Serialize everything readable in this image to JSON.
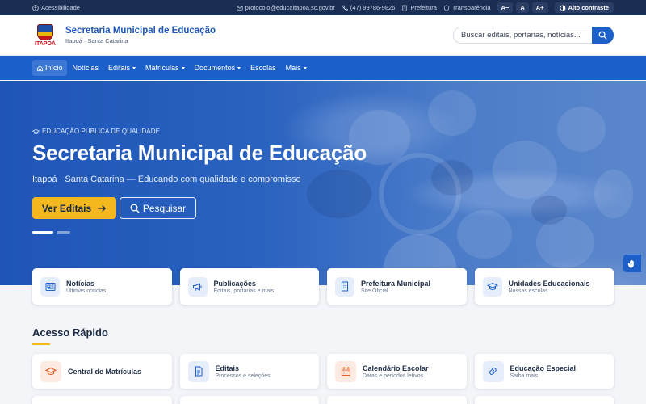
{
  "topbar": {
    "accessibility": "Acessibilidade",
    "email": "protocolo@educaitapoa.sc.gov.br",
    "phone": "(47) 99786-9826",
    "prefeitura": "Prefeitura",
    "transparencia": "Transparência",
    "font_decrease": "A−",
    "font_reset": "A",
    "font_increase": "A+",
    "contrast": "Alto contraste"
  },
  "header": {
    "logo_text": "ITAPOÁ",
    "title": "Secretaria Municipal de Educação",
    "subtitle": "Itapoá · Santa Catarina",
    "search_placeholder": "Buscar editais, portarias, notícias..."
  },
  "nav": {
    "items": [
      {
        "label": "Início",
        "active": true,
        "dropdown": false
      },
      {
        "label": "Notícias",
        "dropdown": false
      },
      {
        "label": "Editais",
        "dropdown": true
      },
      {
        "label": "Matrículas",
        "dropdown": true
      },
      {
        "label": "Documentos",
        "dropdown": true
      },
      {
        "label": "Escolas",
        "dropdown": false
      },
      {
        "label": "Mais",
        "dropdown": true
      }
    ]
  },
  "hero": {
    "tag": "EDUCAÇÃO PÚBLICA DE QUALIDADE",
    "title": "Secretaria Municipal de Educação",
    "subtitle": "Itapoá · Santa Catarina — Educando com qualidade e compromisso",
    "primary_button": "Ver Editais",
    "secondary_button": "Pesquisar"
  },
  "cards": [
    {
      "title": "Notícias",
      "subtitle": "Últimas notícias",
      "icon": "newspaper-icon"
    },
    {
      "title": "Publicações",
      "subtitle": "Editais, portarias e mais",
      "icon": "megaphone-icon"
    },
    {
      "title": "Prefeitura Municipal",
      "subtitle": "Site Oficial",
      "icon": "building-icon"
    },
    {
      "title": "Unidades Educacionais",
      "subtitle": "Nossas escolas",
      "icon": "graduation-cap-icon"
    }
  ],
  "quick_access": {
    "heading": "Acesso Rápido",
    "items": [
      {
        "title": "Central de Matrículas",
        "subtitle": "",
        "icon": "graduation-cap-icon",
        "color": "#fdebe3"
      },
      {
        "title": "Editais",
        "subtitle": "Processos e seleções",
        "icon": "document-icon",
        "color": "#e6eefb"
      },
      {
        "title": "Calendário Escolar",
        "subtitle": "Datas e períodos letivos",
        "icon": "calendar-icon",
        "color": "#fdebe3"
      },
      {
        "title": "Educação Especial",
        "subtitle": "Saiba mais",
        "icon": "link-icon",
        "color": "#e6eefb"
      }
    ]
  },
  "colors": {
    "primary": "#1d5fc8",
    "accent": "#f2b81d",
    "topbar": "#1a2d52"
  }
}
